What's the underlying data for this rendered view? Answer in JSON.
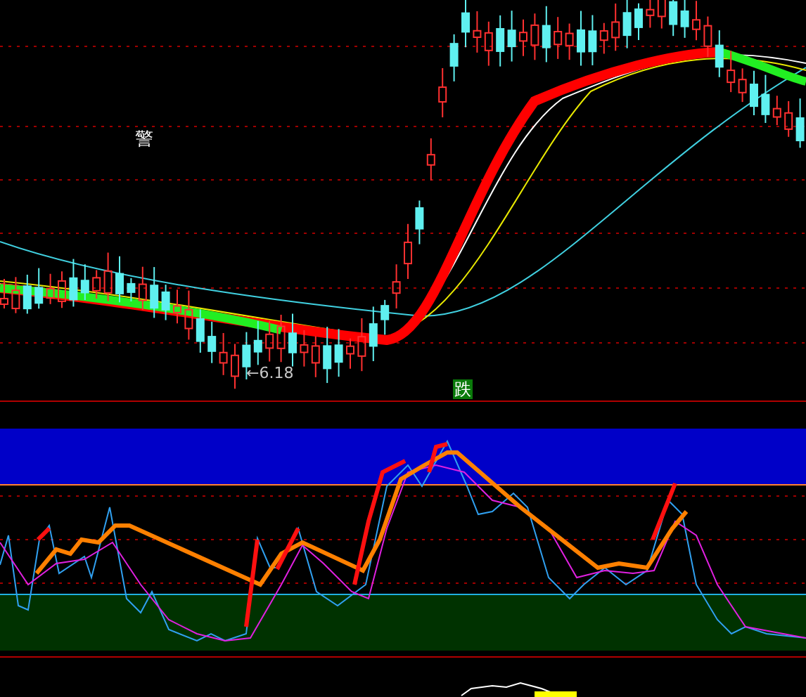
{
  "main_chart": {
    "alert_label": "警",
    "low_price_label": "←6.18",
    "signal_badge": "跌"
  }
}
